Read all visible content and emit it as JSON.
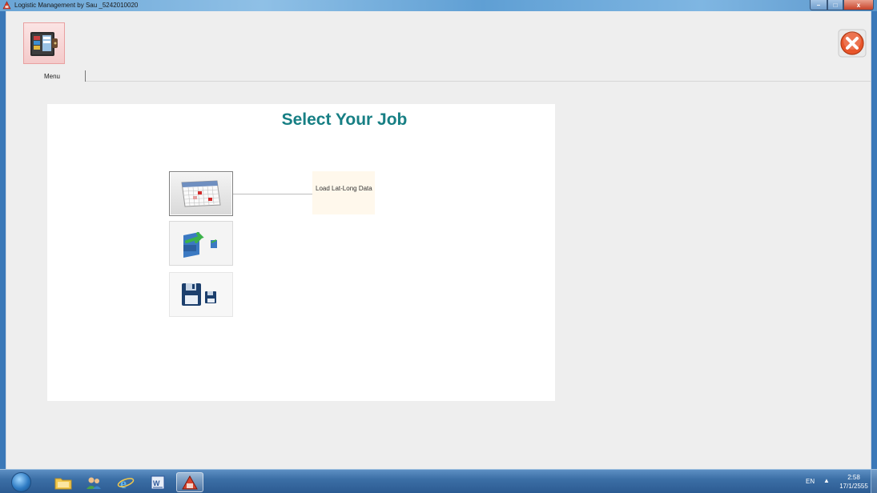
{
  "window": {
    "title": "Logistic Management by Sau _5242010020",
    "minimize_label": "–",
    "maximize_label": "□",
    "close_label": "x"
  },
  "ribbon": {
    "tabs": [
      {
        "label": "Menu"
      }
    ]
  },
  "panel": {
    "title": "Select Your Job",
    "jobs": [
      {
        "icon": "calendar-icon",
        "tooltip": "Load Lat-Long Data"
      },
      {
        "icon": "transfer-arrow-icon"
      },
      {
        "icon": "floppy-disk-icon"
      }
    ]
  },
  "taskbar": {
    "language": "EN",
    "tray_arrow": "▲",
    "time": "2:58",
    "date": "17/1/2555",
    "items": [
      "folder-icon",
      "people-icon",
      "internet-explorer-icon",
      "word-icon",
      "logistic-app-icon"
    ]
  },
  "colors": {
    "title_accent": "#177f84",
    "exit_button": "#e8552a",
    "taskbar": "#2c5b92"
  }
}
